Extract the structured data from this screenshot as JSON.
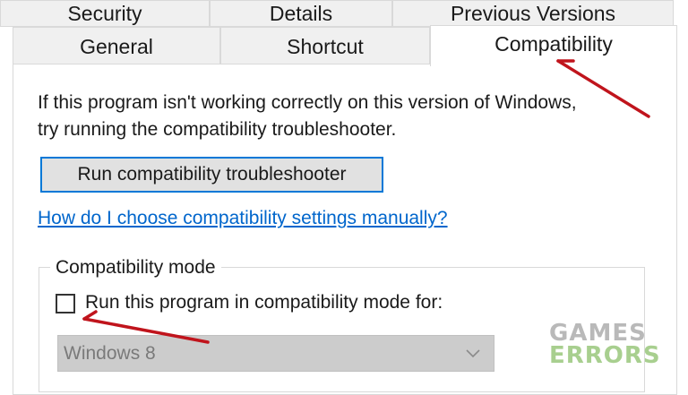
{
  "tabs": {
    "row1": [
      "Security",
      "Details",
      "Previous Versions"
    ],
    "row2": [
      "General",
      "Shortcut",
      "Compatibility"
    ],
    "active": "Compatibility"
  },
  "description": {
    "line1": "If this program isn't working correctly on this version of Windows,",
    "line2": "try running the compatibility troubleshooter."
  },
  "run_button_label": "Run compatibility troubleshooter",
  "help_link": "How do I choose compatibility settings manually?",
  "compat_mode": {
    "title": "Compatibility mode",
    "checkbox_label": "Run this program in compatibility mode for:",
    "checked": false,
    "selected_os": "Windows 8"
  },
  "watermark": {
    "line1": "GAMES",
    "line2": "ERRORS"
  },
  "colors": {
    "annotation_arrow": "#c0141c",
    "link": "#0066cc",
    "focus_border": "#0078d7"
  }
}
